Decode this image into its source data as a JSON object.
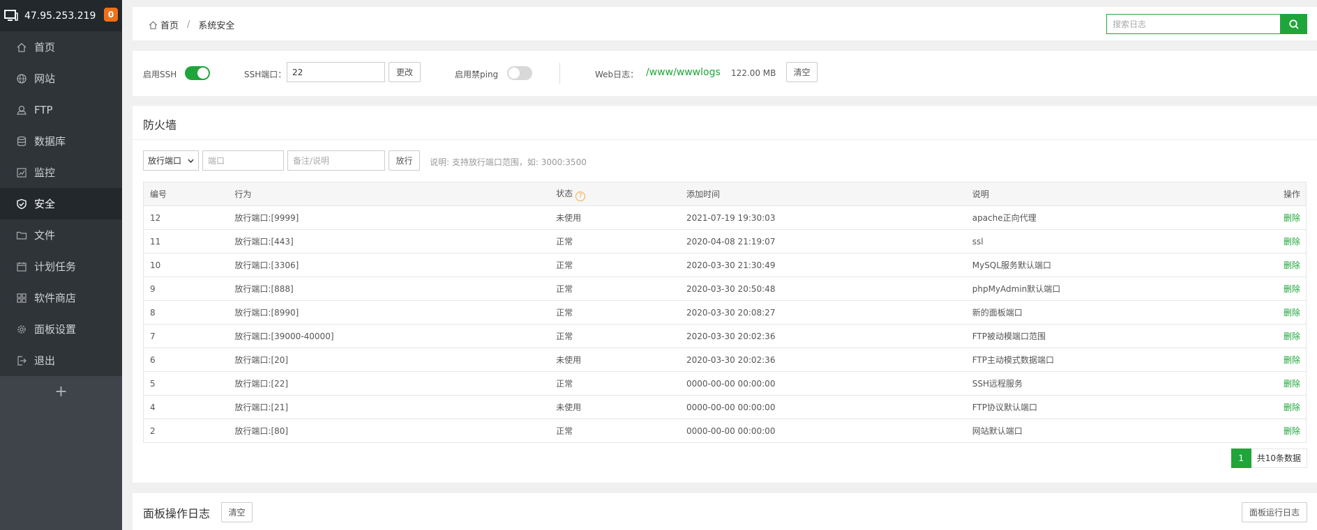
{
  "sidebar": {
    "ip": "47.95.253.219",
    "badge": "0",
    "items": [
      {
        "label": "首页"
      },
      {
        "label": "网站"
      },
      {
        "label": "FTP"
      },
      {
        "label": "数据库"
      },
      {
        "label": "监控"
      },
      {
        "label": "安全"
      },
      {
        "label": "文件"
      },
      {
        "label": "计划任务"
      },
      {
        "label": "软件商店"
      },
      {
        "label": "面板设置"
      },
      {
        "label": "退出"
      }
    ],
    "add": "+"
  },
  "header": {
    "breadcrumb_home": "首页",
    "breadcrumb_sep": "/",
    "breadcrumb_current": "系统安全",
    "search_placeholder": "搜索日志"
  },
  "ssh": {
    "enable_label": "启用SSH",
    "enable_on": true,
    "port_label": "SSH端口：",
    "port_value": "22",
    "change_btn": "更改",
    "ping_label": "启用禁ping",
    "ping_on": false,
    "weblog_label": "Web日志：",
    "weblog_path": "/www/wwwlogs",
    "weblog_size": "122.00 MB",
    "clear_btn": "清空"
  },
  "firewall": {
    "title": "防火墙",
    "select_value": "放行端口",
    "port_placeholder": "端口",
    "remark_placeholder": "备注/说明",
    "allow_btn": "放行",
    "tip": "说明: 支持放行端口范围，如: 3000:3500",
    "columns": {
      "id": "编号",
      "action": "行为",
      "status": "状态",
      "help": "?",
      "time": "添加时间",
      "desc": "说明",
      "op": "操作"
    },
    "rows": [
      {
        "id": "12",
        "action": "放行端口:[9999]",
        "status": "未使用",
        "time": "2021-07-19 19:30:03",
        "desc": "apache正向代理",
        "op": "删除"
      },
      {
        "id": "11",
        "action": "放行端口:[443]",
        "status": "正常",
        "time": "2020-04-08 21:19:07",
        "desc": "ssl",
        "op": "删除"
      },
      {
        "id": "10",
        "action": "放行端口:[3306]",
        "status": "正常",
        "time": "2020-03-30 21:30:49",
        "desc": "MySQL服务默认端口",
        "op": "删除"
      },
      {
        "id": "9",
        "action": "放行端口:[888]",
        "status": "正常",
        "time": "2020-03-30 20:50:48",
        "desc": "phpMyAdmin默认端口",
        "op": "删除"
      },
      {
        "id": "8",
        "action": "放行端口:[8990]",
        "status": "正常",
        "time": "2020-03-30 20:08:27",
        "desc": "新的面板端口",
        "op": "删除"
      },
      {
        "id": "7",
        "action": "放行端口:[39000-40000]",
        "status": "正常",
        "time": "2020-03-30 20:02:36",
        "desc": "FTP被动模端口范围",
        "op": "删除"
      },
      {
        "id": "6",
        "action": "放行端口:[20]",
        "status": "未使用",
        "time": "2020-03-30 20:02:36",
        "desc": "FTP主动模式数据端口",
        "op": "删除"
      },
      {
        "id": "5",
        "action": "放行端口:[22]",
        "status": "正常",
        "time": "0000-00-00 00:00:00",
        "desc": "SSH远程服务",
        "op": "删除"
      },
      {
        "id": "4",
        "action": "放行端口:[21]",
        "status": "未使用",
        "time": "0000-00-00 00:00:00",
        "desc": "FTP协议默认端口",
        "op": "删除"
      },
      {
        "id": "2",
        "action": "放行端口:[80]",
        "status": "正常",
        "time": "0000-00-00 00:00:00",
        "desc": "网站默认端口",
        "op": "删除"
      }
    ],
    "page": "1",
    "total": "共10条数据"
  },
  "panel_log": {
    "title": "面板操作日志",
    "clear_btn": "清空",
    "run_log_btn": "面板运行日志"
  },
  "colors": {
    "accent": "#20a53a",
    "sidebar_bg": "#3e444a",
    "sidebar_active": "#23282d",
    "badge": "#f0701a"
  }
}
